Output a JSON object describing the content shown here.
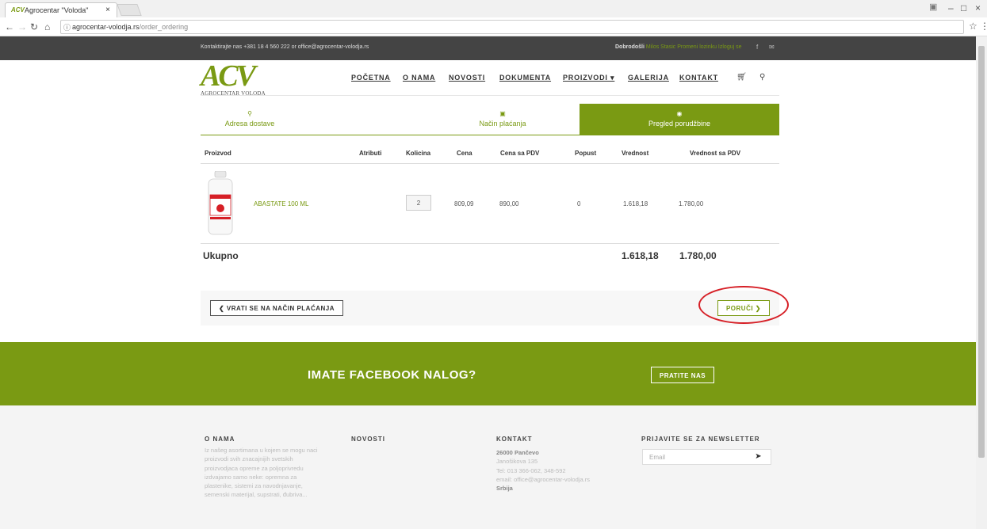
{
  "browser": {
    "tab_title": "Agrocentar \"Voloda\"",
    "tab_close": "×",
    "url_host": "agrocentar-volodja.rs",
    "url_path": "/order_ordering",
    "minimize": "–",
    "maximize": "□",
    "close": "×"
  },
  "topbar": {
    "contact": "Kontaktirajte nas +381 18 4 560 222 or office@agrocentar-volodja.rs",
    "welcome": "Dobrodošli",
    "user": "Milos Stasic Promeni lozinku Izloguj se"
  },
  "logo": {
    "mark": "ACV",
    "subtitle": "AGROCENTAR VOLODA"
  },
  "menu": {
    "items": [
      "POČETNA",
      "O NAMA",
      "NOVOSTI",
      "DOKUMENTA",
      "PROIZVODI ▾",
      "GALERIJA",
      "KONTAKT"
    ]
  },
  "steps": [
    {
      "label": "Adresa dostave",
      "icon": "map-marker-icon"
    },
    {
      "label": "Način plaćanja",
      "icon": "money-icon"
    },
    {
      "label": "Pregled porudžbine",
      "icon": "eye-icon"
    }
  ],
  "table": {
    "headers": [
      "Proizvod",
      "Atributi",
      "Kolicina",
      "Cena",
      "Cena sa PDV",
      "Popust",
      "Vrednost",
      "Vrednost sa PDV"
    ],
    "row": {
      "name": "ABASTATE 100 ML",
      "quantity": "2",
      "price": "809,09",
      "price_vat": "890,00",
      "discount": "0",
      "value": "1.618,18",
      "value_vat": "1.780,00"
    },
    "total_label": "Ukupno",
    "total_value": "1.618,18",
    "total_value_vat": "1.780,00"
  },
  "actions": {
    "back": "❮ VRATI SE NA NAČIN PLAĆANJA",
    "order": "PORUČI ❯"
  },
  "facebook": {
    "title": "IMATE FACEBOOK NALOG?",
    "button": "PRATITE NAS"
  },
  "footer": {
    "about_title": "O NAMA",
    "about_text": "Iz našeg asortimana u kojem se mogu naci proizvodi svih znacajnijih svetskih proizvodjaca opreme za poljoprivredu izdvajamo samo neke: opremna za plastenike, sistemi za navodnjavanje, semenski materijal, supstrati, đubriva...",
    "news_title": "NOVOSTI",
    "contact_title": "KONTAKT",
    "city": "26000 Pančevo",
    "street": "Janošikova 135",
    "phone": "Tel: 013 366-062, 348-592",
    "email": "email: office@agrocentar-volodja.rs",
    "country": "Srbija",
    "newsletter_title": "PRIJAVITE SE ZA NEWSLETTER",
    "newsletter_placeholder": "Email"
  },
  "colors": {
    "brand_green": "#7a9a13",
    "annotation_red": "#d61f26"
  }
}
